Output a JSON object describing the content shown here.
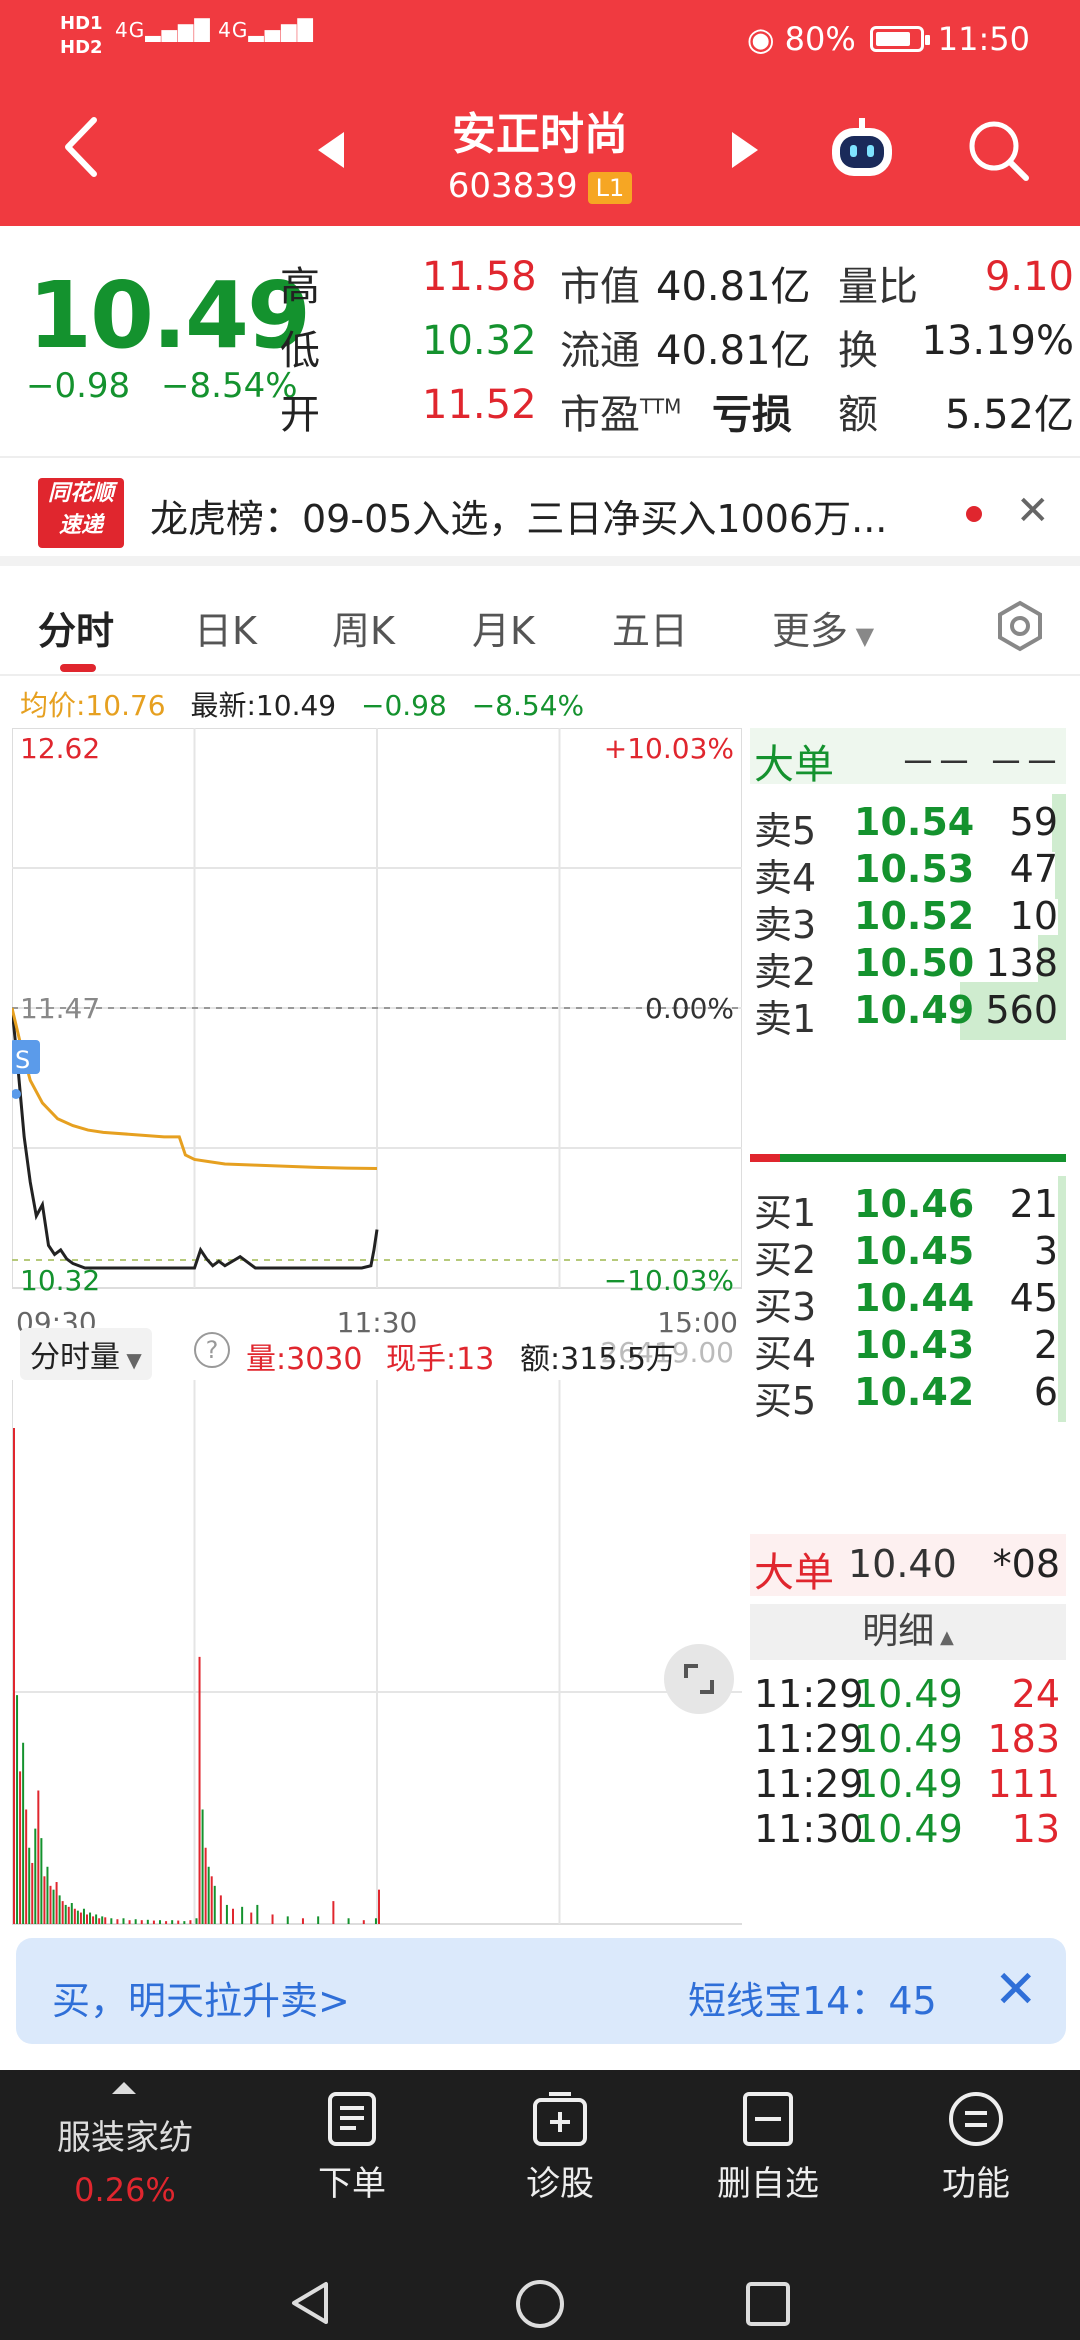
{
  "status_bar": {
    "hd1": "HD1",
    "hd2": "HD2",
    "signal1": "4G",
    "signal2": "4G",
    "battery_pct": "80%",
    "time": "11:50",
    "battery_level": 0.8
  },
  "header": {
    "name": "安正时尚",
    "code": "603839",
    "level": "L1"
  },
  "quote": {
    "last": "10.49",
    "change": "−0.98",
    "change_pct": "−8.54%",
    "high_label": "高",
    "high": "11.58",
    "low_label": "低",
    "low": "10.32",
    "open_label": "开",
    "open": "11.52",
    "mktcap_label": "市值",
    "mktcap": "40.81亿",
    "float_label": "流通",
    "float": "40.81亿",
    "pe_label": "市盈",
    "pe_sup": "TTM",
    "pe": "亏损",
    "volratio_label": "量比",
    "volratio": "9.10",
    "turnover_label": "换",
    "turnover": "13.19%",
    "amount_label": "额",
    "amount": "5.52亿"
  },
  "alert": {
    "logo_top": "同花顺",
    "logo_bottom": "速递",
    "text": "龙虎榜：09-05入选，三日净买入1006万..."
  },
  "tabs": [
    "分时",
    "日K",
    "周K",
    "月K",
    "五日",
    "更多"
  ],
  "infoline": {
    "avg_label": "均价:10.76",
    "latest_label": "最新:10.49",
    "chg": "−0.98",
    "pct": "−8.54%"
  },
  "chart_data": {
    "type": "line",
    "title": "",
    "x_ticks": [
      "09:30",
      "11:30",
      "15:00"
    ],
    "y_max": "12.62",
    "y_min": "10.32",
    "y_ref": "11.47",
    "pct_max": "+10.03%",
    "pct_ref": "0.00%",
    "pct_min": "−10.03%",
    "ylim": [
      10.32,
      12.62
    ],
    "marker": "S",
    "series": [
      {
        "name": "",
        "color": "#222222",
        "x": [
          0,
          2,
          4,
          6,
          8,
          10,
          12,
          14,
          16,
          18,
          20,
          22,
          24,
          26,
          28,
          30,
          35,
          40,
          45,
          50,
          55,
          60,
          62,
          64,
          66,
          68,
          70,
          75,
          80,
          85,
          90,
          95,
          100,
          105,
          110,
          115,
          118,
          119,
          120
        ],
        "y": [
          11.47,
          11.2,
          10.9,
          10.7,
          10.55,
          10.6,
          10.42,
          10.38,
          10.4,
          10.36,
          10.34,
          10.33,
          10.32,
          10.32,
          10.32,
          10.32,
          10.32,
          10.32,
          10.32,
          10.32,
          10.32,
          10.32,
          10.4,
          10.36,
          10.33,
          10.35,
          10.33,
          10.37,
          10.32,
          10.32,
          10.32,
          10.32,
          10.32,
          10.32,
          10.32,
          10.32,
          10.33,
          10.4,
          10.49
        ]
      },
      {
        "name": "",
        "color": "#e6a020",
        "x": [
          0,
          3,
          6,
          10,
          15,
          20,
          25,
          30,
          40,
          50,
          55,
          57,
          60,
          65,
          70,
          80,
          90,
          100,
          110,
          120
        ],
        "y": [
          11.47,
          11.3,
          11.15,
          11.05,
          10.98,
          10.95,
          10.93,
          10.92,
          10.91,
          10.9,
          10.9,
          10.82,
          10.8,
          10.79,
          10.78,
          10.775,
          10.77,
          10.765,
          10.762,
          10.76
        ]
      }
    ],
    "volume": {
      "label": "分时量",
      "vol": "量:3030",
      "cur": "现手:13",
      "amt": "额:315.5万",
      "max": "26419.00",
      "x": [
        0,
        1,
        2,
        3,
        4,
        5,
        6,
        7,
        8,
        9,
        10,
        11,
        12,
        13,
        14,
        15,
        16,
        17,
        18,
        19,
        20,
        21,
        22,
        23,
        24,
        25,
        26,
        27,
        28,
        29,
        30,
        32,
        34,
        36,
        38,
        40,
        42,
        44,
        46,
        48,
        50,
        52,
        54,
        56,
        58,
        60,
        61,
        62,
        63,
        64,
        65,
        66,
        68,
        70,
        72,
        75,
        78,
        80,
        85,
        90,
        95,
        100,
        105,
        110,
        115,
        119,
        120
      ],
      "values": [
        26000,
        12000,
        8000,
        9500,
        6000,
        4000,
        3200,
        5000,
        7000,
        4500,
        2500,
        3000,
        2000,
        1800,
        2200,
        1500,
        1200,
        1000,
        900,
        1100,
        800,
        700,
        600,
        800,
        500,
        600,
        400,
        500,
        300,
        400,
        350,
        300,
        250,
        300,
        200,
        250,
        200,
        220,
        180,
        200,
        150,
        200,
        180,
        150,
        200,
        300,
        14000,
        6000,
        4000,
        3000,
        2500,
        2000,
        1500,
        1000,
        800,
        900,
        600,
        1000,
        500,
        400,
        300,
        400,
        1200,
        300,
        200,
        300,
        1800
      ],
      "colors_up": [
        1,
        0,
        1,
        0,
        1,
        0,
        1,
        0,
        1,
        0,
        1,
        0,
        1,
        0,
        1,
        0,
        1,
        0,
        1,
        0,
        1,
        0,
        1,
        0,
        1,
        0,
        1,
        0,
        1,
        0,
        1,
        0,
        1,
        0,
        1,
        0,
        1,
        0,
        1,
        0,
        1,
        0,
        1,
        0,
        1,
        0,
        1,
        0,
        1,
        0,
        1,
        0,
        1,
        0,
        1,
        0,
        1,
        0,
        1,
        0,
        1,
        0,
        1,
        0,
        1,
        0,
        1
      ],
      "ylim": [
        0,
        26419
      ]
    }
  },
  "orderbook": {
    "big_label": "大单",
    "big_a": "－－",
    "big_b": "－－",
    "asks": [
      {
        "l": "卖5",
        "p": "10.54",
        "v": "59",
        "share": 0.05
      },
      {
        "l": "卖4",
        "p": "10.53",
        "v": "47",
        "share": 0.04
      },
      {
        "l": "卖3",
        "p": "10.52",
        "v": "10",
        "share": 0.01
      },
      {
        "l": "卖2",
        "p": "10.50",
        "v": "138",
        "share": 0.1
      },
      {
        "l": "卖1",
        "p": "10.49",
        "v": "560",
        "share": 0.38
      }
    ],
    "bids": [
      {
        "l": "买1",
        "p": "10.46",
        "v": "21",
        "share": 0.02
      },
      {
        "l": "买2",
        "p": "10.45",
        "v": "3",
        "share": 0.01
      },
      {
        "l": "买3",
        "p": "10.44",
        "v": "45",
        "share": 0.03
      },
      {
        "l": "买4",
        "p": "10.43",
        "v": "2",
        "share": 0.01
      },
      {
        "l": "买5",
        "p": "10.42",
        "v": "6",
        "share": 0.01
      }
    ],
    "big2_label": "大单",
    "big2_price": "10.40",
    "big2_vol": "*08",
    "detail_label": "明细",
    "trades": [
      {
        "t": "11:29",
        "p": "10.49",
        "v": "24"
      },
      {
        "t": "11:29",
        "p": "10.49",
        "v": "183"
      },
      {
        "t": "11:29",
        "p": "10.49",
        "v": "111"
      },
      {
        "t": "11:30",
        "p": "10.49",
        "v": "13"
      }
    ]
  },
  "promo": {
    "left": "买，明天拉升卖>",
    "right": "短线宝14：45"
  },
  "bottom": {
    "sector": "服装家纺",
    "sector_chg": "0.26%",
    "items": [
      "下单",
      "诊股",
      "删自选",
      "功能"
    ]
  }
}
